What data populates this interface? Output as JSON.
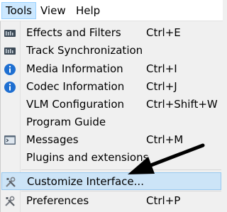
{
  "menubar": {
    "tools": "Tools",
    "view": "View",
    "help": "Help"
  },
  "menu": {
    "items": [
      {
        "label": "Effects and Filters",
        "shortcut": "Ctrl+E",
        "icon": "equalizer-icon"
      },
      {
        "label": "Track Synchronization",
        "shortcut": "",
        "icon": "equalizer-icon"
      },
      {
        "label": "Media Information",
        "shortcut": "Ctrl+I",
        "icon": "info-icon"
      },
      {
        "label": "Codec Information",
        "shortcut": "Ctrl+J",
        "icon": "info-icon"
      },
      {
        "label": "VLM Configuration",
        "shortcut": "Ctrl+Shift+W",
        "icon": ""
      },
      {
        "label": "Program Guide",
        "shortcut": "",
        "icon": ""
      },
      {
        "label": "Messages",
        "shortcut": "Ctrl+M",
        "icon": "terminal-icon"
      },
      {
        "label": "Plugins and extensions",
        "shortcut": "",
        "icon": ""
      },
      {
        "label": "Customize Interface...",
        "shortcut": "",
        "icon": "tools-icon"
      },
      {
        "label": "Preferences",
        "shortcut": "Ctrl+P",
        "icon": "tools-icon"
      }
    ]
  },
  "colors": {
    "highlight": "#cce4f7",
    "info_blue": "#1f6fd1",
    "arrow": "#000000"
  }
}
